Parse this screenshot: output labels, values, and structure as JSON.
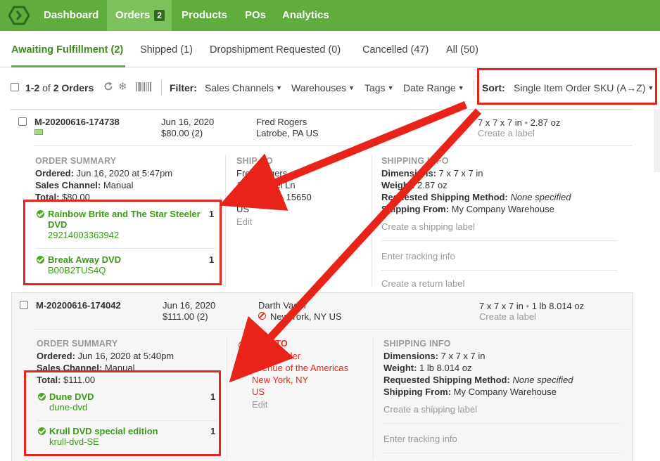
{
  "nav": {
    "items": [
      {
        "label": "Dashboard"
      },
      {
        "label": "Orders",
        "badge": "2"
      },
      {
        "label": "Products"
      },
      {
        "label": "POs"
      },
      {
        "label": "Analytics"
      }
    ]
  },
  "tabs": [
    {
      "label": "Awaiting Fulfillment (2)"
    },
    {
      "label": "Shipped (1)"
    },
    {
      "label": "Dropshipment Requested (0)"
    },
    {
      "label": "Cancelled (47)"
    },
    {
      "label": "All (50)"
    }
  ],
  "toolbar": {
    "count_bold": "1-2",
    "count_of": "of",
    "count_rest": "2 Orders",
    "filter_label": "Filter:",
    "filters": [
      "Sales Channels",
      "Warehouses",
      "Tags",
      "Date Range"
    ],
    "sort_label": "Sort:",
    "sort_value": "Single Item Order SKU (A→Z)"
  },
  "orders": [
    {
      "id": "M-20200616-174738",
      "date": "Jun 16, 2020",
      "total": "$80.00 (2)",
      "customer": "Fred Rogers",
      "location": "Latrobe, PA US",
      "dims": "7 x 7 x 7 in",
      "weight": "2.87 oz",
      "create_label": "Create a label",
      "summary_title": "ORDER SUMMARY",
      "ordered_label": "Ordered:",
      "ordered": "Jun 16, 2020 at 5:47pm",
      "channel_label": "Sales Channel:",
      "channel": "Manual",
      "total_label": "Total:",
      "total_value": "$80.00",
      "items": [
        {
          "name": "Rainbow Brite and The Star Steeler",
          "name2": "DVD",
          "sku": "29214003363942",
          "qty": "1"
        },
        {
          "name": "Break Away DVD",
          "name2": "",
          "sku": "B00B2TUS4Q",
          "qty": "1"
        }
      ],
      "shipto_title": "SHIP-TO",
      "ship_name": "Fred Rogers",
      "ship_street": "114 Chapel Ln",
      "ship_city": "Latrobe, PA 15650",
      "ship_country": "US",
      "edit": "Edit",
      "shipinfo_title": "SHIPPING INFO",
      "dims_label": "Dimensions:",
      "weight_label": "Weight:",
      "method_label": "Requested Shipping Method:",
      "method": "None specified",
      "from_label": "Shipping From:",
      "from": "My Company Warehouse",
      "create_shipping_label": "Create a shipping label",
      "tracking": "Enter tracking info",
      "return_label": "Create a return label"
    },
    {
      "id": "M-20200616-174042",
      "date": "Jun 16, 2020",
      "total": "$111.00 (2)",
      "customer": "Darth Vader",
      "location": "New York, NY US",
      "dims": "7 x 7 x 7 in",
      "weight": "1 lb  8.014 oz",
      "create_label": "Create a label",
      "summary_title": "ORDER SUMMARY",
      "ordered_label": "Ordered:",
      "ordered": "Jun 16, 2020 at 5:40pm",
      "channel_label": "Sales Channel:",
      "channel": "Manual",
      "total_label": "Total:",
      "total_value": "$111.00",
      "items": [
        {
          "name": "Dune DVD",
          "name2": "",
          "sku": "dune-dvd",
          "qty": "1"
        },
        {
          "name": "Krull DVD special edition",
          "name2": "",
          "sku": "krull-dvd-SE",
          "qty": "1"
        }
      ],
      "shipto_title": "SHIP-TO",
      "ship_name": "Darth Vader",
      "ship_street": "Avenue of the Americas",
      "ship_city": "New York, NY",
      "ship_country": "US",
      "edit": "Edit",
      "shipinfo_title": "SHIPPING INFO",
      "dims_label": "Dimensions:",
      "weight_label": "Weight:",
      "method_label": "Requested Shipping Method:",
      "method": "None specified",
      "from_label": "Shipping From:",
      "from": "My Company Warehouse",
      "create_shipping_label": "Create a shipping label",
      "tracking": "Enter tracking info"
    }
  ],
  "colors": {
    "brand_green": "#5fad3c",
    "link_green": "#3d9a1a",
    "annotation_red": "#e8231a"
  }
}
